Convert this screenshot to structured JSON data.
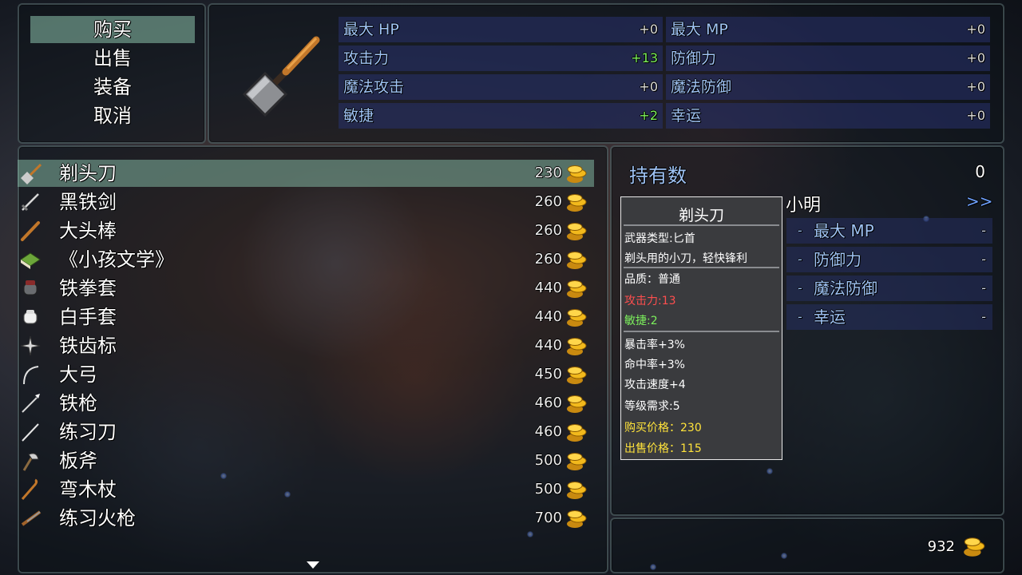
{
  "commands": [
    {
      "label": "购买",
      "selected": true
    },
    {
      "label": "出售",
      "selected": false
    },
    {
      "label": "装备",
      "selected": false
    },
    {
      "label": "取消",
      "selected": false
    }
  ],
  "compare": {
    "weapon_icon": "cleaver-icon",
    "stats": [
      {
        "label": "最大 HP",
        "value": "+0",
        "up": false
      },
      {
        "label": "最大 MP",
        "value": "+0",
        "up": false
      },
      {
        "label": "攻击力",
        "value": "+13",
        "up": true
      },
      {
        "label": "防御力",
        "value": "+0",
        "up": false
      },
      {
        "label": "魔法攻击",
        "value": "+0",
        "up": false
      },
      {
        "label": "魔法防御",
        "value": "+0",
        "up": false
      },
      {
        "label": "敏捷",
        "value": "+2",
        "up": true
      },
      {
        "label": "幸运",
        "value": "+0",
        "up": false
      }
    ]
  },
  "items": [
    {
      "name": "剃头刀",
      "price": "230",
      "icon": "cleaver-icon",
      "selected": true
    },
    {
      "name": "黑铁剑",
      "price": "260",
      "icon": "sword-icon",
      "selected": false
    },
    {
      "name": "大头棒",
      "price": "260",
      "icon": "club-icon",
      "selected": false
    },
    {
      "name": "《小孩文学》",
      "price": "260",
      "icon": "book-icon",
      "selected": false
    },
    {
      "name": "铁拳套",
      "price": "440",
      "icon": "iron-gauntlet-icon",
      "selected": false
    },
    {
      "name": "白手套",
      "price": "440",
      "icon": "white-glove-icon",
      "selected": false
    },
    {
      "name": "铁齿标",
      "price": "440",
      "icon": "shuriken-icon",
      "selected": false
    },
    {
      "name": "大弓",
      "price": "450",
      "icon": "bow-icon",
      "selected": false
    },
    {
      "name": "铁枪",
      "price": "460",
      "icon": "spear-icon",
      "selected": false
    },
    {
      "name": "练习刀",
      "price": "460",
      "icon": "practice-blade-icon",
      "selected": false
    },
    {
      "name": "板斧",
      "price": "500",
      "icon": "axe-icon",
      "selected": false
    },
    {
      "name": "弯木杖",
      "price": "500",
      "icon": "staff-icon",
      "selected": false
    },
    {
      "name": "练习火枪",
      "price": "700",
      "icon": "musket-icon",
      "selected": false
    }
  ],
  "status": {
    "owned_label": "持有数",
    "owned_value": "0",
    "actor_name": "小明",
    "prev_arrow": "<<",
    "next_arrow": ">>",
    "actor_stats": [
      {
        "label": "最大 MP",
        "value": "-"
      },
      {
        "label": "防御力",
        "value": "-"
      },
      {
        "label": "魔法防御",
        "value": "-"
      },
      {
        "label": "幸运",
        "value": "-"
      }
    ]
  },
  "tooltip": {
    "title": "剃头刀",
    "type_line": "武器类型:匕首",
    "desc_line": "剃头用的小刀，轻快锋利",
    "quality_line": "品质：普通",
    "atk_line": "攻击力:13",
    "agi_line": "敏捷:2",
    "crit_line": "暴击率+3%",
    "hit_line": "命中率+3%",
    "aspd_line": "攻击速度+4",
    "level_line": "等级需求:5",
    "buy_line": "购买价格：230",
    "sell_line": "出售价格：115"
  },
  "gold": {
    "amount": "932"
  },
  "colors": {
    "highlight": "#82b4a0",
    "stat_label": "#9fc3f5",
    "positive": "#7cf05c",
    "negative": "#ff4e4e",
    "price_yellow": "#ffe33b",
    "gold": "#f2b91c"
  }
}
